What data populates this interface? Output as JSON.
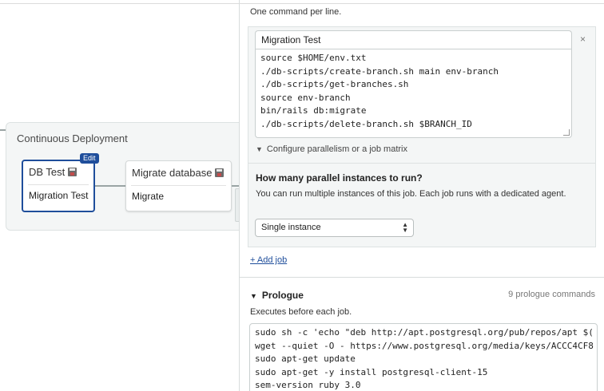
{
  "canvas": {
    "block_title": "Continuous Deployment",
    "jobs": [
      {
        "title": "DB Test",
        "body": "Migration Test",
        "badge": "Edit",
        "selected": true
      },
      {
        "title": "Migrate database",
        "body": "Migrate",
        "selected": false
      }
    ],
    "icons": {
      "job_icon": "floppy-disk-icon"
    }
  },
  "panel": {
    "hint": "One command per line.",
    "job": {
      "name_value": "Migration Test",
      "commands": [
        "source $HOME/env.txt",
        "./db-scripts/create-branch.sh main env-branch",
        "./db-scripts/get-branches.sh",
        "source env-branch",
        "bin/rails db:migrate",
        "./db-scripts/delete-branch.sh $BRANCH_ID"
      ],
      "close_icon": "×",
      "parallelism_toggle": "Configure parallelism or a job matrix",
      "parallel_question": "How many parallel instances to run?",
      "parallel_description": "You can run multiple instances of this job. Each job runs with a dedicated agent.",
      "instances_value": "Single instance"
    },
    "add_job": "+ Add job",
    "prologue": {
      "title": "Prologue",
      "count": "9 prologue commands",
      "description": "Executes before each job.",
      "commands": [
        "sudo sh -c 'echo \"deb http://apt.postgresql.org/pub/repos/apt $(",
        "wget --quiet -O - https://www.postgresql.org/media/keys/ACCC4CF8",
        "sudo apt-get update",
        "sudo apt-get -y install postgresql-client-15",
        "sem-version ruby 3.0"
      ]
    }
  },
  "colors": {
    "accent": "#1f4e9b",
    "connector": "#9aa4a4",
    "block_bg": "#f4f6f6"
  }
}
